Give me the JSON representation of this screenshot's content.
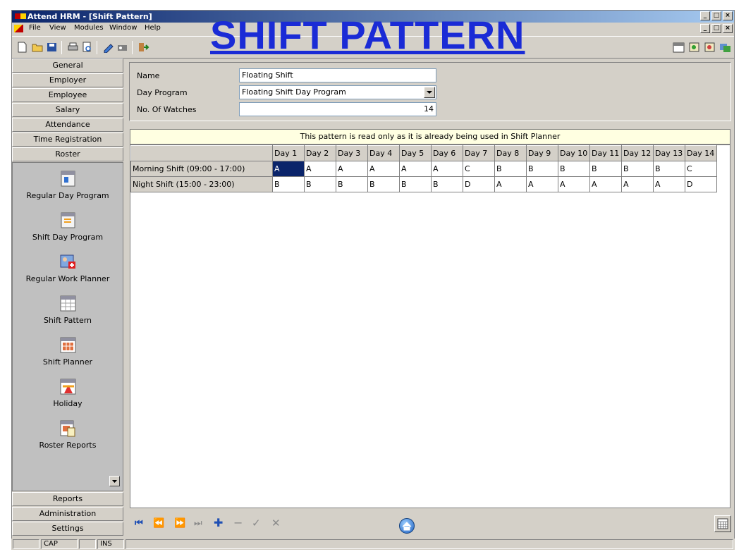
{
  "window": {
    "title": "Attend HRM - [Shift Pattern]",
    "controls": {
      "minimize": "_",
      "maximize": "□",
      "close": "×"
    }
  },
  "menu": [
    "File",
    "View",
    "Modules",
    "Window",
    "Help"
  ],
  "overlay_title": "SHIFT PATTERN",
  "nav": {
    "top_buttons": [
      "General",
      "Employer",
      "Employee",
      "Salary",
      "Attendance",
      "Time Registration",
      "Roster"
    ],
    "items": [
      "Regular Day Program",
      "Shift Day Program",
      "Regular Work Planner",
      "Shift Pattern",
      "Shift Planner",
      "Holiday",
      "Roster Reports"
    ],
    "bottom_buttons": [
      "Reports",
      "Administration",
      "Settings"
    ]
  },
  "form": {
    "name_label": "Name",
    "name_value": "Floating Shift",
    "day_program_label": "Day Program",
    "day_program_value": "Floating Shift Day Program",
    "watches_label": "No. Of Watches",
    "watches_value": "14"
  },
  "notice": "This pattern is read only as it is already being used in Shift Planner",
  "grid": {
    "columns": [
      "Day 1",
      "Day 2",
      "Day 3",
      "Day 4",
      "Day 5",
      "Day 6",
      "Day 7",
      "Day 8",
      "Day 9",
      "Day 10",
      "Day 11",
      "Day 12",
      "Day 13",
      "Day 14"
    ],
    "rows": [
      {
        "label": "Morning Shift (09:00 - 17:00)",
        "values": [
          "A",
          "A",
          "A",
          "A",
          "A",
          "A",
          "C",
          "B",
          "B",
          "B",
          "B",
          "B",
          "B",
          "C"
        ]
      },
      {
        "label": "Night Shift (15:00 - 23:00)",
        "values": [
          "B",
          "B",
          "B",
          "B",
          "B",
          "B",
          "D",
          "A",
          "A",
          "A",
          "A",
          "A",
          "A",
          "D"
        ]
      }
    ]
  },
  "status": {
    "cap": "CAP",
    "ins": "INS"
  },
  "colors": {
    "selection": "#0a246a",
    "title_overlay": "#1a2bd6",
    "notice_bg": "#ffffe1"
  }
}
